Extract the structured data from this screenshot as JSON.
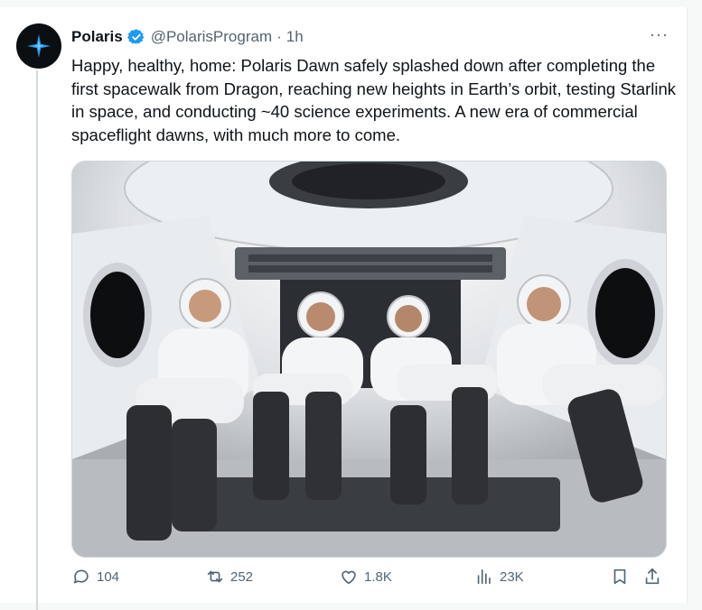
{
  "post": {
    "author_name": "Polaris",
    "handle": "@PolarisProgram",
    "separator": "·",
    "time": "1h",
    "more": "···",
    "text": "Happy, healthy, home: Polaris Dawn safely splashed down after completing the first spacewalk from Dragon, reaching new heights in Earth’s orbit, testing Starlink in space, and conducting ~40 science experiments. A new era of commercial spaceflight dawns, with much more to come."
  },
  "actions": {
    "replies": "104",
    "reposts": "252",
    "likes": "1.8K",
    "views": "23K"
  },
  "colors": {
    "verified": "#1d9bf0",
    "muted": "#536471",
    "avatar_bg": "#0c0f12",
    "star": "#1d9bf0"
  },
  "icons": [
    "polaris-star-icon",
    "verified-badge-icon",
    "more-icon",
    "reply-icon",
    "repost-icon",
    "like-icon",
    "views-icon",
    "bookmark-icon",
    "share-icon"
  ]
}
